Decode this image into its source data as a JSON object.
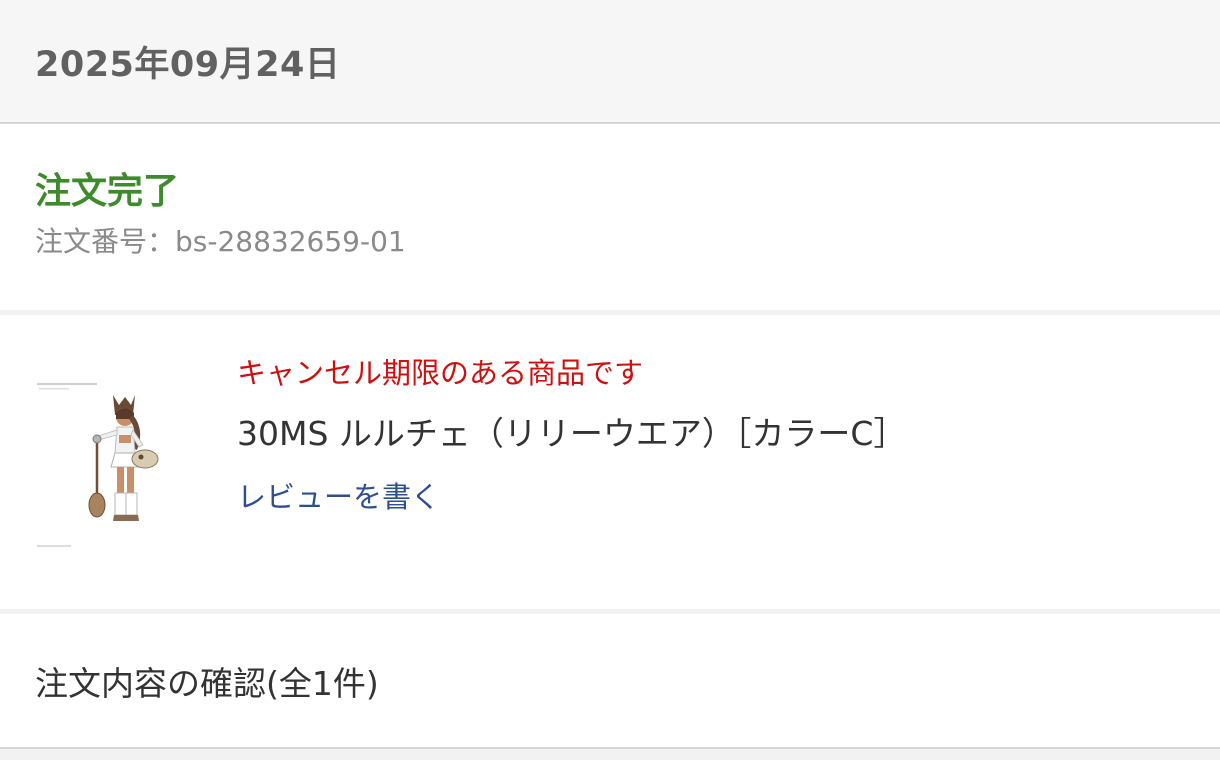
{
  "header": {
    "date": "2025年09月24日"
  },
  "order": {
    "status": "注文完了",
    "number_label": "注文番号：bs-28832659-01",
    "status_color": "#3e8a2d"
  },
  "product": {
    "cancel_note": "キャンセル期限のある商品です",
    "name": "30MS ルルチェ（リリーウエア）［カラーC］",
    "review_link": "レビューを書く",
    "thumbnail": "figure-thumbnail",
    "cancel_color": "#cc1111",
    "link_color": "#2e4f8f"
  },
  "confirm": {
    "label": "注文内容の確認(全1件)"
  }
}
